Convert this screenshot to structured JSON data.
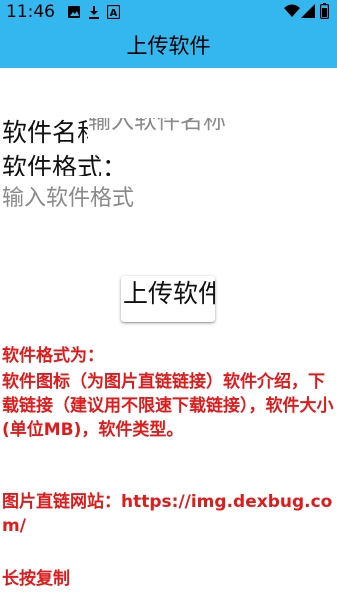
{
  "status_bar": {
    "time": "11:46",
    "left_icons": [
      "image-icon",
      "download-icon",
      "text-a-icon"
    ],
    "right_icons": [
      "wifi-icon",
      "signal-icon",
      "battery-icon"
    ]
  },
  "app_bar": {
    "title": "上传软件"
  },
  "form": {
    "name_label": "软件名称",
    "name_placeholder": "输入软件名称",
    "format_label": "软件格式：",
    "format_placeholder": "输入软件格式",
    "upload_button": "上传软件"
  },
  "notes": {
    "heading": "软件格式为：",
    "body": "软件图标（为图片直链链接）软件介绍，下载链接（建议用不限速下载链接），软件大小(单位MB)，软件类型。",
    "site": "图片直链网站：https://img.dexbug.com/",
    "copy_hint": "长按复制"
  },
  "colors": {
    "bar": "#34b7ee",
    "note_text": "#e01b1b"
  }
}
